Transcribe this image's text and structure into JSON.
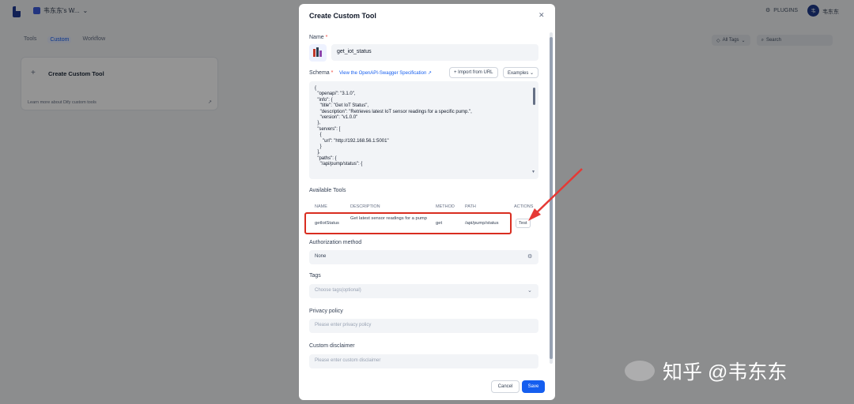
{
  "workspace": {
    "name": "韦东东's W..."
  },
  "header": {
    "plugins_label": "PLUGINS",
    "avatar_initial": "韦",
    "user_name": "韦东东"
  },
  "tabs": [
    {
      "label": "Tools"
    },
    {
      "label": "Custom"
    },
    {
      "label": "Workflow"
    }
  ],
  "filters": {
    "tags_label": "All Tags",
    "search_placeholder": "Search"
  },
  "card": {
    "title": "Create Custom Tool",
    "learn_link": "Learn more about Dify custom tools"
  },
  "modal": {
    "title": "Create Custom Tool",
    "name_label": "Name",
    "name_value": "get_iot_status",
    "schema_label": "Schema",
    "schema_link": "View the OpenAPI-Swagger Specification",
    "import_label": "Import from URL",
    "examples_label": "Examples",
    "schema_code": "{\n  \"openapi\": \"3.1.0\",\n  \"info\": {\n    \"title\": \"Get IoT Status\",\n    \"description\": \"Retrieves latest IoT sensor readings for a specific pump.\",\n    \"version\": \"v1.0.0\"\n  },\n  \"servers\": [\n    {\n      \"url\": \"http://192.168.56.1:5001\"\n    }\n  ],\n  \"paths\": {\n    \"/api/pump/status\": {",
    "available_tools_label": "Available Tools",
    "tools_headers": {
      "name": "NAME",
      "description": "DESCRIPTION",
      "method": "METHOD",
      "path": "PATH",
      "actions": "ACTIONS"
    },
    "tools": [
      {
        "name": "getIotStatus",
        "description": "Get latest sensor readings for a pump",
        "method": "get",
        "path": "/api/pump/status",
        "action": "Test"
      }
    ],
    "auth_label": "Authorization method",
    "auth_value": "None",
    "tags_label": "Tags",
    "tags_placeholder": "Choose tags(optional)",
    "privacy_label": "Privacy policy",
    "privacy_placeholder": "Please enter privacy policy",
    "disclaimer_label": "Custom disclaimer",
    "disclaimer_placeholder": "Please enter custom disclaimer",
    "cancel_label": "Cancel",
    "save_label": "Save"
  },
  "watermark": {
    "text": "知乎 @韦东东"
  }
}
